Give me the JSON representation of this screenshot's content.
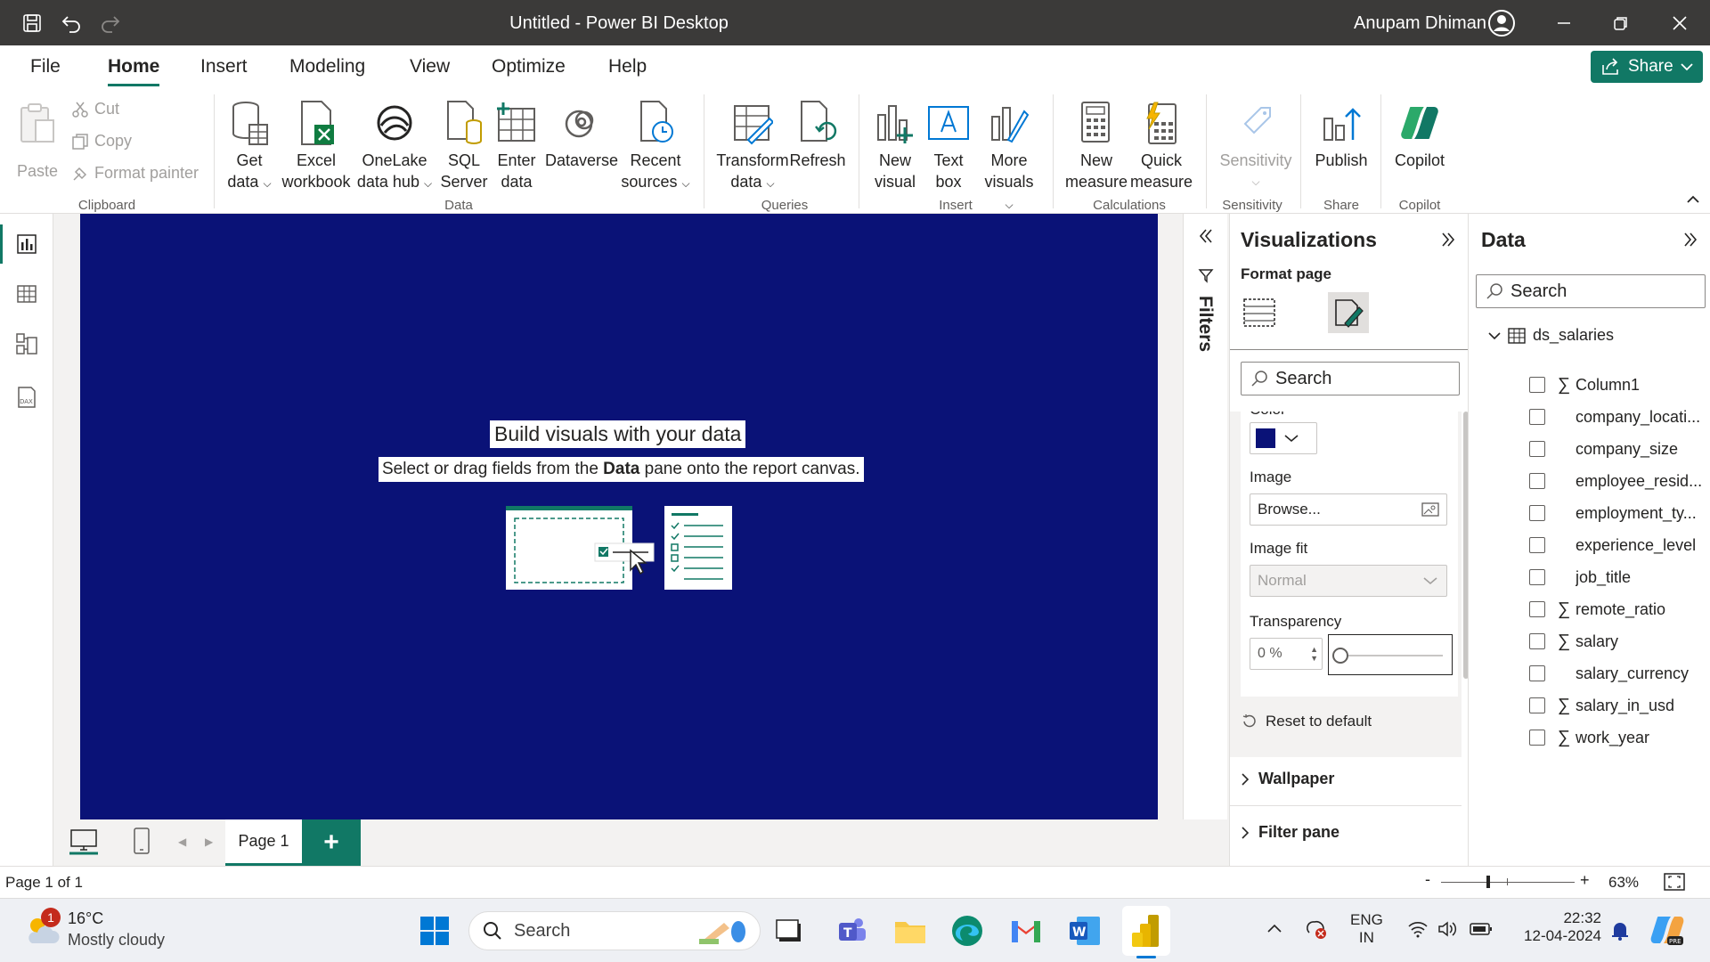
{
  "window": {
    "title": "Untitled - Power BI Desktop",
    "user": "Anupam Dhiman"
  },
  "menu": {
    "tabs": [
      "File",
      "Home",
      "Insert",
      "Modeling",
      "View",
      "Optimize",
      "Help"
    ],
    "active": "Home",
    "share_label": "Share"
  },
  "ribbon": {
    "clipboard": {
      "paste": "Paste",
      "cut": "Cut",
      "copy": "Copy",
      "format_painter": "Format painter",
      "group": "Clipboard"
    },
    "data": {
      "get_data": [
        "Get",
        "data"
      ],
      "excel": [
        "Excel",
        "workbook"
      ],
      "onelake": [
        "OneLake",
        "data hub"
      ],
      "sql": [
        "SQL",
        "Server"
      ],
      "enter": [
        "Enter",
        "data"
      ],
      "dataverse": "Dataverse",
      "recent": [
        "Recent",
        "sources"
      ],
      "group": "Data"
    },
    "queries": {
      "transform": [
        "Transform",
        "data"
      ],
      "refresh": "Refresh",
      "group": "Queries"
    },
    "insert": {
      "new_visual": [
        "New",
        "visual"
      ],
      "text_box": [
        "Text",
        "box"
      ],
      "more_visuals": [
        "More",
        "visuals"
      ],
      "group": "Insert"
    },
    "calculations": {
      "new_measure": [
        "New",
        "measure"
      ],
      "quick_measure": [
        "Quick",
        "measure"
      ],
      "group": "Calculations"
    },
    "sensitivity": {
      "label": "Sensitivity",
      "group": "Sensitivity"
    },
    "share": {
      "publish": "Publish",
      "group": "Share"
    },
    "copilot": {
      "label": "Copilot",
      "group": "Copilot"
    }
  },
  "canvas": {
    "title": "Build visuals with your data",
    "subtitle_pre": "Select or drag fields from the ",
    "subtitle_bold": "Data",
    "subtitle_post": " pane onto the report canvas.",
    "background_color": "#0a1277"
  },
  "pages": {
    "tabs": [
      "Page 1"
    ],
    "add": "+"
  },
  "status": {
    "page_info": "Page 1 of 1",
    "zoom": "63%",
    "zoom_minus": "-",
    "zoom_plus": "+"
  },
  "filters": {
    "label": "Filters"
  },
  "visualizations": {
    "title": "Visualizations",
    "subtitle": "Format page",
    "search_placeholder": "Search",
    "color_label_partial": "Color",
    "swatch_color": "#0a1277",
    "image_label": "Image",
    "image_browse": "Browse...",
    "image_fit_label": "Image fit",
    "image_fit_value": "Normal",
    "transparency_label": "Transparency",
    "transparency_value": "0 %",
    "transparency_level": 0,
    "reset": "Reset to default",
    "sections": [
      "Wallpaper",
      "Filter pane"
    ]
  },
  "data_pane": {
    "title": "Data",
    "search_placeholder": "Search",
    "table": "ds_salaries",
    "fields": [
      {
        "name": "Column1",
        "sigma": true
      },
      {
        "name": "company_locati...",
        "sigma": false
      },
      {
        "name": "company_size",
        "sigma": false
      },
      {
        "name": "employee_resid...",
        "sigma": false
      },
      {
        "name": "employment_ty...",
        "sigma": false
      },
      {
        "name": "experience_level",
        "sigma": false
      },
      {
        "name": "job_title",
        "sigma": false
      },
      {
        "name": "remote_ratio",
        "sigma": true
      },
      {
        "name": "salary",
        "sigma": true
      },
      {
        "name": "salary_currency",
        "sigma": false
      },
      {
        "name": "salary_in_usd",
        "sigma": true
      },
      {
        "name": "work_year",
        "sigma": true
      }
    ]
  },
  "taskbar": {
    "weather_temp": "16°C",
    "weather_desc": "Mostly cloudy",
    "weather_badge": "1",
    "search": "Search",
    "lang1": "ENG",
    "lang2": "IN",
    "time": "22:32",
    "date": "12-04-2024"
  }
}
